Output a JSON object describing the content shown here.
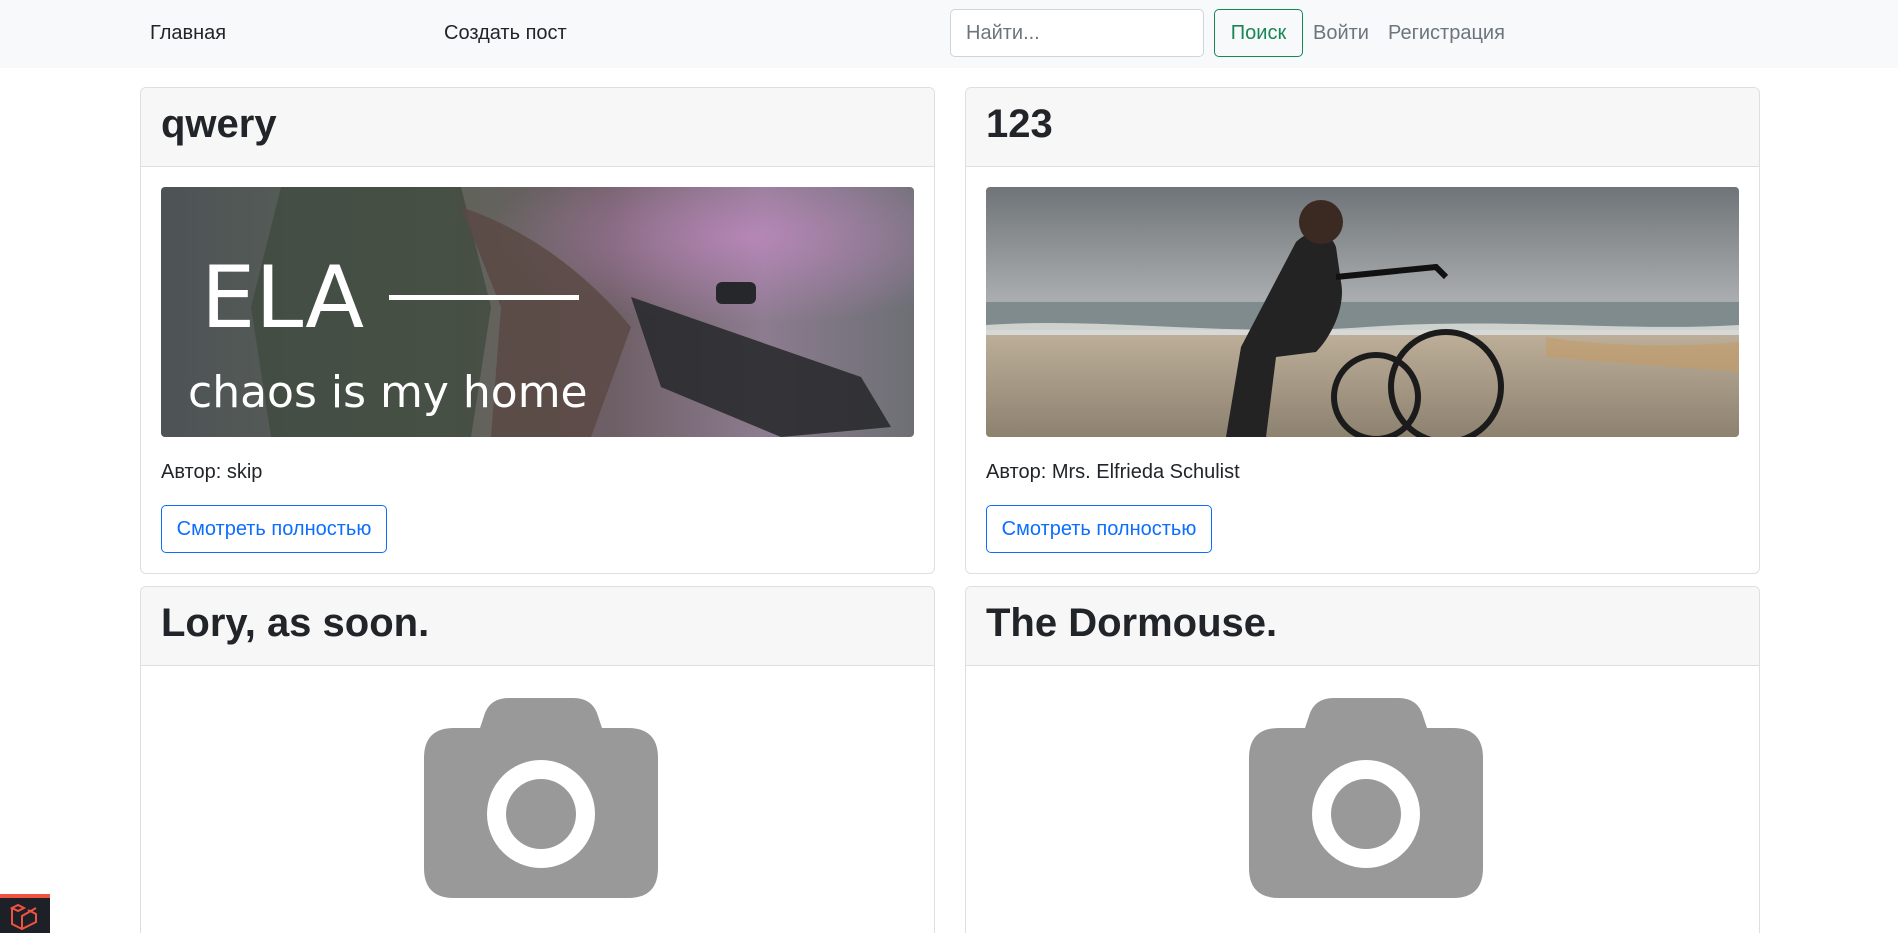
{
  "navbar": {
    "home": "Главная",
    "create_post": "Создать пост",
    "search_placeholder": "Найти...",
    "search_button": "Поиск",
    "login": "Войти",
    "register": "Регистрация"
  },
  "posts": [
    {
      "title": "qwery",
      "image_text_main": "ELA",
      "image_text_sub": "chaos is my home",
      "author": "Автор: skip",
      "button": "Смотреть полностью"
    },
    {
      "title": "123",
      "author": "Автор: Mrs. Elfrieda Schulist",
      "button": "Смотреть полностью"
    },
    {
      "title": "Lory, as soon.",
      "image": "camera-placeholder-icon"
    },
    {
      "title": "The Dormouse.",
      "image": "camera-placeholder-icon"
    }
  ],
  "colors": {
    "navbar_bg": "#f8f9fa",
    "search_button": "#198754",
    "primary": "#0d6efd",
    "muted": "#6c757d",
    "placeholder_gray": "#999999"
  }
}
